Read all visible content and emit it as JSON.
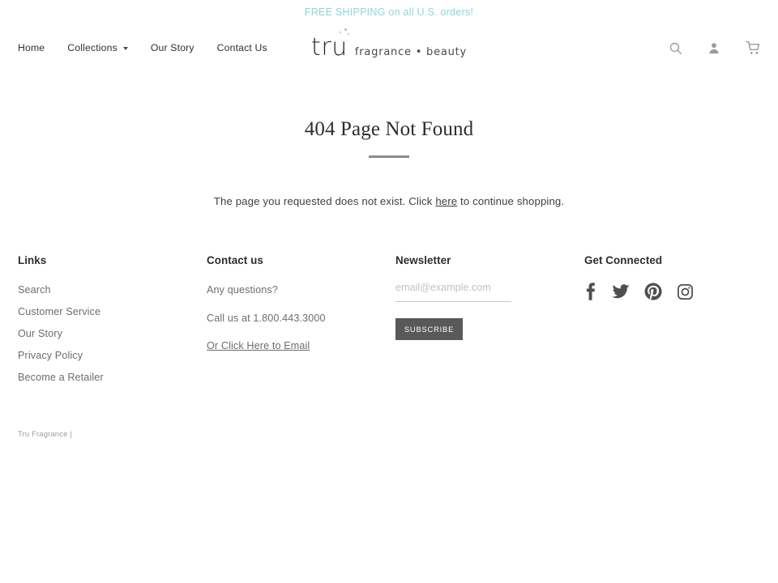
{
  "announcement": {
    "text": "FREE SHIPPING on all U.S. orders!",
    "color": "#8ed5da"
  },
  "header": {
    "nav": [
      {
        "label": "Home",
        "has_dropdown": false
      },
      {
        "label": "Collections",
        "has_dropdown": true
      },
      {
        "label": "Our Story",
        "has_dropdown": false
      },
      {
        "label": "Contact Us",
        "has_dropdown": false
      }
    ],
    "logo": {
      "mark": "tru",
      "tagline": "fragrance • beauty"
    },
    "icons": [
      {
        "name": "search-icon"
      },
      {
        "name": "account-icon"
      },
      {
        "name": "cart-icon"
      }
    ]
  },
  "main": {
    "title": "404 Page Not Found",
    "body_before": "The page you requested does not exist. Click ",
    "body_link": "here",
    "body_after": " to continue shopping."
  },
  "footer": {
    "links": {
      "heading": "Links",
      "items": [
        {
          "label": "Search"
        },
        {
          "label": "Customer Service"
        },
        {
          "label": "Our Story"
        },
        {
          "label": "Privacy Policy"
        },
        {
          "label": "Become a Retailer"
        }
      ]
    },
    "contact": {
      "heading": "Contact us",
      "question": "Any questions?",
      "phone": "Call us at 1.800.443.3000",
      "email_link": "Or Click Here to Email"
    },
    "newsletter": {
      "heading": "Newsletter",
      "placeholder": "email@example.com",
      "value": "",
      "button_label": "SUBSCRIBE",
      "button_color": "#595959"
    },
    "social": {
      "heading": "Get Connected",
      "items": [
        {
          "name": "facebook-icon"
        },
        {
          "name": "twitter-icon"
        },
        {
          "name": "pinterest-icon"
        },
        {
          "name": "instagram-icon"
        }
      ]
    },
    "copyright": "Tru Fragrance |"
  }
}
